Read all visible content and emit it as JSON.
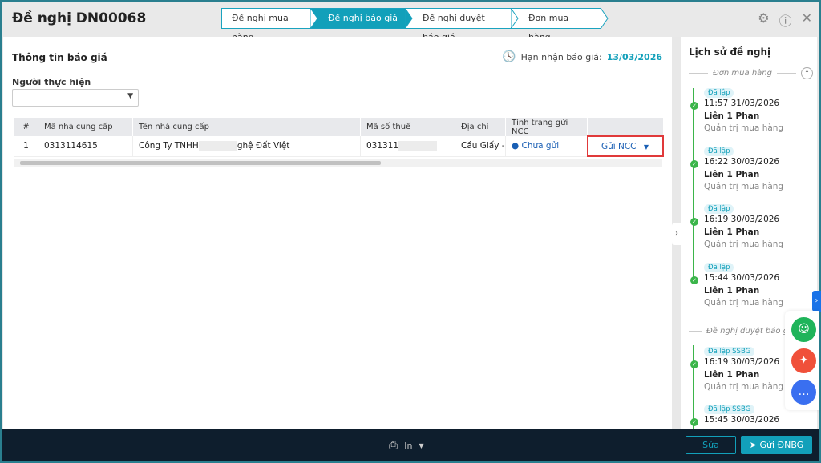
{
  "header": {
    "title": "Đề nghị DN00068",
    "steps": [
      "Đề nghị mua hàng",
      "Đề nghị báo giá",
      "Đề nghị duyệt báo giá",
      "Đơn mua hàng"
    ],
    "active_step": 1
  },
  "main": {
    "section_title": "Thông tin báo giá",
    "deadline_label": "Hạn nhận báo giá:",
    "deadline": "13/03/2026",
    "performer_label": "Người thực hiện",
    "performer_value": "",
    "columns": [
      "#",
      "Mã nhà cung cấp",
      "Tên nhà cung cấp",
      "Mã số thuế",
      "Địa chỉ",
      "Tình trạng gửi NCC",
      ""
    ],
    "rows": [
      {
        "index": "1",
        "code": "0313114615",
        "name_start": "Công Ty TNHH",
        "name_end": "ghệ Đất Việt",
        "tax": "031311",
        "address": "Cầu Giấy - H",
        "status": "Chưa gửi",
        "action": "Gửi NCC"
      }
    ]
  },
  "history": {
    "title": "Lịch sử đề nghị",
    "groups": [
      {
        "label": "Đơn mua hàng",
        "entries": [
          {
            "badge": "Đã lập",
            "time": "11:57 31/03/2026",
            "name": "Liên 1 Phan",
            "role": "Quản trị mua hàng"
          },
          {
            "badge": "Đã lập",
            "time": "16:22 30/03/2026",
            "name": "Liên 1 Phan",
            "role": "Quản trị mua hàng"
          },
          {
            "badge": "Đã lập",
            "time": "16:19 30/03/2026",
            "name": "Liên 1 Phan",
            "role": "Quản trị mua hàng"
          },
          {
            "badge": "Đã lập",
            "time": "15:44 30/03/2026",
            "name": "Liên 1 Phan",
            "role": "Quản trị mua hàng"
          }
        ]
      },
      {
        "label": "Đề nghị duyệt báo giá",
        "entries": [
          {
            "badge": "Đã lập SSBG",
            "time": "16:19 30/03/2026",
            "name": "Liên 1 Phan",
            "role": "Quản trị mua hàng"
          },
          {
            "badge": "Đã lập SSBG",
            "time": "15:45 30/03/2026"
          }
        ]
      }
    ]
  },
  "footer": {
    "print_label": "In",
    "edit_label": "Sửa",
    "send_label": "Gửi ĐNBG"
  },
  "colors": {
    "accent": "#12a0ba",
    "footer": "#0e1e2d",
    "success": "#3bb54a",
    "highlight": "#e0393a"
  }
}
